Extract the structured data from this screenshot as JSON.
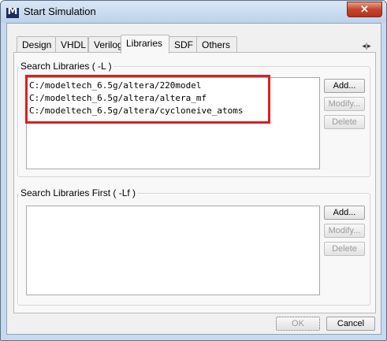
{
  "window": {
    "title": "Start Simulation",
    "icon_letter": "M",
    "close_glyph": "✕"
  },
  "tabs": [
    {
      "label": "Design"
    },
    {
      "label": "VHDL"
    },
    {
      "label": "Verilog"
    },
    {
      "label": "Libraries"
    },
    {
      "label": "SDF"
    },
    {
      "label": "Others"
    }
  ],
  "active_tab": "Libraries",
  "tab_scroll_glyph": "◂|▸",
  "search_libraries": {
    "legend": "Search Libraries ( -L )",
    "entries": [
      "C:/modeltech_6.5g/altera/220model",
      "C:/modeltech_6.5g/altera/altera_mf",
      "C:/modeltech_6.5g/altera/cycloneive_atoms"
    ],
    "add_label": "Add...",
    "modify_label": "Modify...",
    "delete_label": "Delete"
  },
  "search_libraries_first": {
    "legend": "Search Libraries First ( -Lf )",
    "entries": [],
    "add_label": "Add...",
    "modify_label": "Modify...",
    "delete_label": "Delete"
  },
  "footer": {
    "ok_label": "OK",
    "cancel_label": "Cancel"
  },
  "colors": {
    "highlight": "#e11c1c",
    "titlebar": "#c7d9ee",
    "close_button": "#c7442a"
  }
}
